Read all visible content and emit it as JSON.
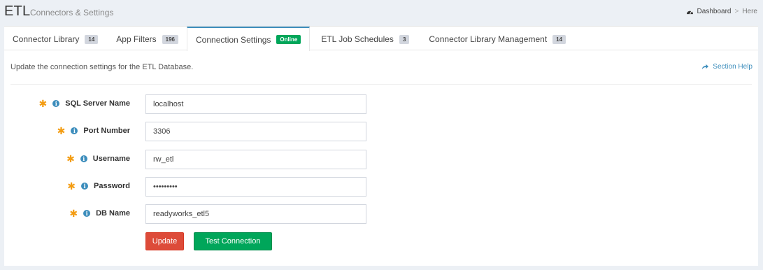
{
  "header": {
    "title": "ETL",
    "subtitle": "Connectors & Settings",
    "breadcrumb": {
      "dashboard": "Dashboard",
      "separator": ">",
      "current": "Here"
    }
  },
  "tabs": [
    {
      "label": "Connector Library",
      "badge": "14"
    },
    {
      "label": "App Filters",
      "badge": "196"
    },
    {
      "label": "Connection Settings",
      "badge": "Online"
    },
    {
      "label": "ETL Job Schedules",
      "badge": "3"
    },
    {
      "label": "Connector Library Management",
      "badge": "14"
    }
  ],
  "active_tab": "Connection Settings",
  "description": "Update the connection settings for the ETL Database.",
  "section_help": "Section Help",
  "form": {
    "required_marker": "✱",
    "fields": [
      {
        "label": "SQL Server Name",
        "value": "localhost"
      },
      {
        "label": "Port Number",
        "value": "3306"
      },
      {
        "label": "Username",
        "value": "rw_etl"
      },
      {
        "label": "Password",
        "value": "•••••••••"
      },
      {
        "label": "DB Name",
        "value": "readyworks_etl5"
      }
    ]
  },
  "buttons": {
    "update": "Update",
    "test": "Test Connection"
  },
  "colors": {
    "primary": "#3c8dbc",
    "success": "#00a65a",
    "danger": "#dd4b39",
    "required": "#f39c12"
  },
  "icons": [
    "dashboard-icon",
    "share-icon",
    "info-icon",
    "asterisk-icon"
  ]
}
